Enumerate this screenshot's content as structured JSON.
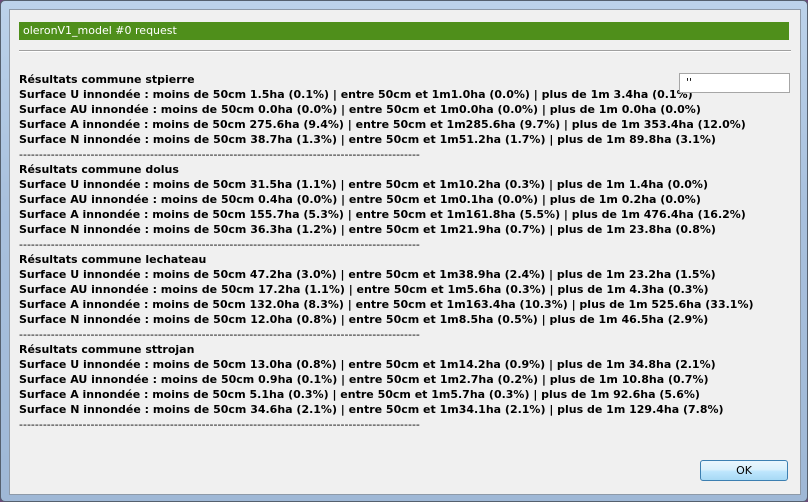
{
  "window": {
    "title": "oleronV1_model #0 request"
  },
  "side_field": {
    "value": "''"
  },
  "results": [
    {
      "title": "Résultats commune stpierre",
      "lines": [
        "Surface U innondée : moins de 50cm 1.5ha (0.1%) | entre 50cm et 1m1.0ha (0.0%) | plus de 1m 3.4ha (0.1%)",
        "Surface AU innondée : moins de 50cm 0.0ha (0.0%) | entre 50cm et 1m0.0ha (0.0%) | plus de 1m 0.0ha (0.0%)",
        "Surface A innondée : moins de 50cm 275.6ha (9.4%) | entre 50cm et 1m285.6ha (9.7%) | plus de 1m 353.4ha (12.0%)",
        "Surface N innondée : moins de 50cm 38.7ha (1.3%) | entre 50cm et 1m51.2ha (1.7%) | plus de 1m 89.8ha (3.1%)"
      ],
      "divider": "-----------------------------------------------------------------------------------------------------"
    },
    {
      "title": "Résultats commune dolus",
      "lines": [
        "Surface U innondée : moins de 50cm 31.5ha (1.1%) | entre 50cm et 1m10.2ha (0.3%) | plus de 1m 1.4ha (0.0%)",
        "Surface AU innondée : moins de 50cm 0.4ha (0.0%) | entre 50cm et 1m0.1ha (0.0%) | plus de 1m 0.2ha (0.0%)",
        "Surface A innondée : moins de 50cm 155.7ha (5.3%) | entre 50cm et 1m161.8ha (5.5%) | plus de 1m 476.4ha (16.2%)",
        "Surface N innondée : moins de 50cm 36.3ha (1.2%) | entre 50cm et 1m21.9ha (0.7%) | plus de 1m 23.8ha (0.8%)"
      ],
      "divider": "-----------------------------------------------------------------------------------------------------"
    },
    {
      "title": "Résultats commune lechateau",
      "lines": [
        "Surface U innondée : moins de 50cm 47.2ha (3.0%) | entre 50cm et 1m38.9ha (2.4%) | plus de 1m 23.2ha (1.5%)",
        "Surface AU innondée : moins de 50cm 17.2ha (1.1%) | entre 50cm et 1m5.6ha (0.3%) | plus de 1m 4.3ha (0.3%)",
        "Surface A innondée : moins de 50cm 132.0ha (8.3%) | entre 50cm et 1m163.4ha (10.3%) | plus de 1m 525.6ha (33.1%)",
        "Surface N innondée : moins de 50cm 12.0ha (0.8%) | entre 50cm et 1m8.5ha (0.5%) | plus de 1m 46.5ha (2.9%)"
      ],
      "divider": "-----------------------------------------------------------------------------------------------------"
    },
    {
      "title": "Résultats commune sttrojan",
      "lines": [
        "Surface U innondée : moins de 50cm 13.0ha (0.8%) | entre 50cm et 1m14.2ha (0.9%) | plus de 1m 34.8ha (2.1%)",
        "Surface AU innondée : moins de 50cm 0.9ha (0.1%) | entre 50cm et 1m2.7ha (0.2%) | plus de 1m 10.8ha (0.7%)",
        "Surface A innondée : moins de 50cm 5.1ha (0.3%) | entre 50cm et 1m5.7ha (0.3%) | plus de 1m 92.6ha (5.6%)",
        "Surface N innondée : moins de 50cm 34.6ha (2.1%) | entre 50cm et 1m34.1ha (2.1%) | plus de 1m 129.4ha (7.8%)"
      ],
      "divider": "-----------------------------------------------------------------------------------------------------"
    }
  ],
  "buttons": {
    "ok_label": "OK"
  }
}
